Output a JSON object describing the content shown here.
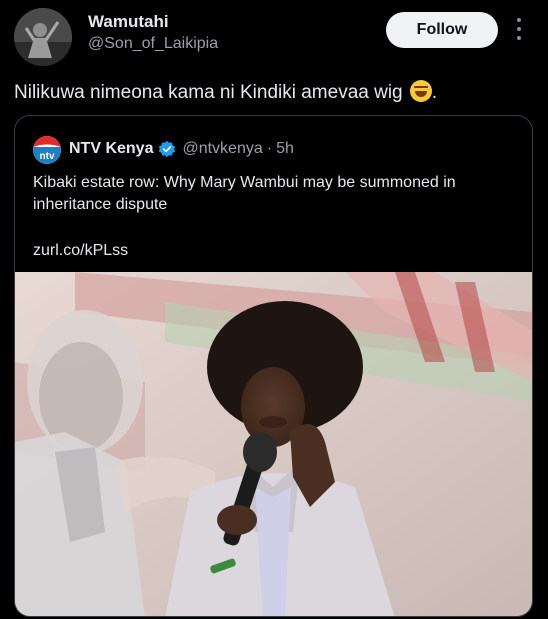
{
  "tweet": {
    "author": {
      "display_name": "Wamutahi",
      "handle": "@Son_of_Laikipia"
    },
    "follow_label": "Follow",
    "text": "Nilikuwa nimeona kama ni Kindiki amevaa wig",
    "trailing_text": ".",
    "emoji": "laughing-face"
  },
  "quote": {
    "avatar_label": "ntv",
    "display_name": "NTV Kenya",
    "verified": true,
    "handle": "@ntvkenya",
    "separator": "·",
    "time": "5h",
    "text": "Kibaki estate row: Why Mary Wambui may be summoned in inheritance dispute",
    "link": "zurl.co/kPLss",
    "image": "news-photo-woman-speaking-at-microphone"
  },
  "colors": {
    "background": "#000000",
    "text": "#e7e9ea",
    "secondary_text": "#9aa0a6",
    "follow_bg": "#eff3f4",
    "verified_blue": "#1d9bf0",
    "card_border": "#3a3d41"
  }
}
